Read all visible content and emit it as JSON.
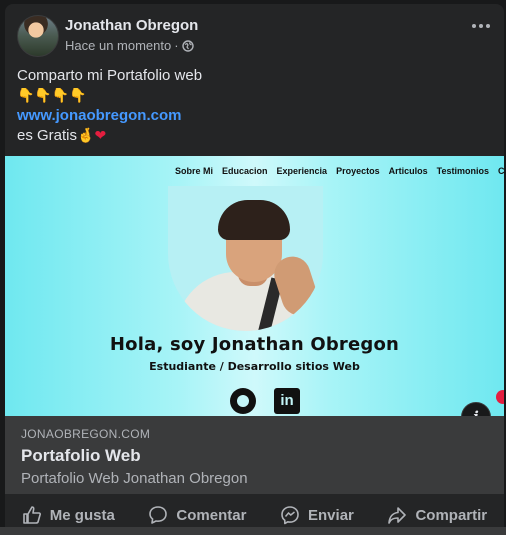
{
  "post": {
    "author": "Jonathan Obregon",
    "time": "Hace un momento",
    "privacy_icon": "globe-icon",
    "text": {
      "line1": "Comparto mi Portafolio web",
      "line2_emojis": "👇👇👇👇",
      "link": "www.jonaobregon.com",
      "line4": "es Gratis",
      "line4_emojis": "🤞",
      "heart": "❤"
    }
  },
  "preview": {
    "nav": [
      "Sobre Mi",
      "Educacion",
      "Experiencia",
      "Proyectos",
      "Articulos",
      "Testimonios",
      "Co"
    ],
    "hero_title": "Hola, soy Jonathan Obregon",
    "hero_subtitle": "Estudiante / Desarrollo sitios Web",
    "social": {
      "github": "github-icon",
      "linkedin": "in"
    },
    "info": "i"
  },
  "link_card": {
    "domain": "JONAOBREGON.COM",
    "title": "Portafolio Web",
    "description": "Portafolio Web Jonathan Obregon"
  },
  "actions": {
    "like": "Me gusta",
    "comment": "Comentar",
    "send": "Enviar",
    "share": "Compartir"
  },
  "colors": {
    "background": "#18191a",
    "card": "#242526",
    "link": "#4599ff",
    "muted": "#b0b3b8",
    "preview_cyan": "#6fe8f0"
  }
}
